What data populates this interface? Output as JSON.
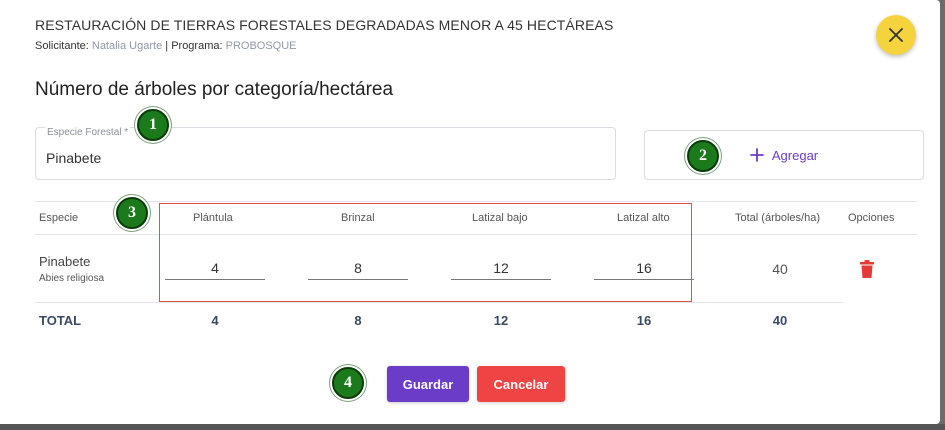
{
  "dialog": {
    "title": "RESTAURACIÓN DE TIERRAS FORESTALES DEGRADADAS MENOR A 45 HECTÁREAS",
    "solicitante_label": "Solicitante:",
    "solicitante_value": "Natalia Ugarte",
    "separator": "|",
    "programa_label": "Programa:",
    "programa_value": "PROBOSQUE",
    "close_icon": "close-icon",
    "section_title": "Número de árboles por categoría/hectárea"
  },
  "form": {
    "species_field_label": "Especie Forestal *",
    "species_field_value": "Pinabete",
    "add_icon": "plus-icon",
    "add_label": "Agregar"
  },
  "table": {
    "headers": {
      "especie": "Especie",
      "plantula": "Plántula",
      "brinzal": "Brinzal",
      "latizal_bajo": "Latizal bajo",
      "latizal_alto": "Latizal alto",
      "total": "Total (árboles/ha)",
      "opciones": "Opciones"
    },
    "rows": [
      {
        "species": "Pinabete",
        "scientific": "Abies religiosa",
        "plantula": "4",
        "brinzal": "8",
        "latizal_bajo": "12",
        "latizal_alto": "16",
        "total": "40",
        "delete_icon": "trash-icon"
      }
    ],
    "totals": {
      "label": "TOTAL",
      "plantula": "4",
      "brinzal": "8",
      "latizal_bajo": "12",
      "latizal_alto": "16",
      "total": "40"
    }
  },
  "actions": {
    "save_label": "Guardar",
    "cancel_label": "Cancelar"
  },
  "annotations": [
    "1",
    "2",
    "3",
    "4"
  ],
  "colors": {
    "accent": "#6a3cc8",
    "danger": "#ef4444",
    "close_bg": "#f5d33f",
    "badge": "#1b7a1b",
    "highlight": "#e05050"
  }
}
